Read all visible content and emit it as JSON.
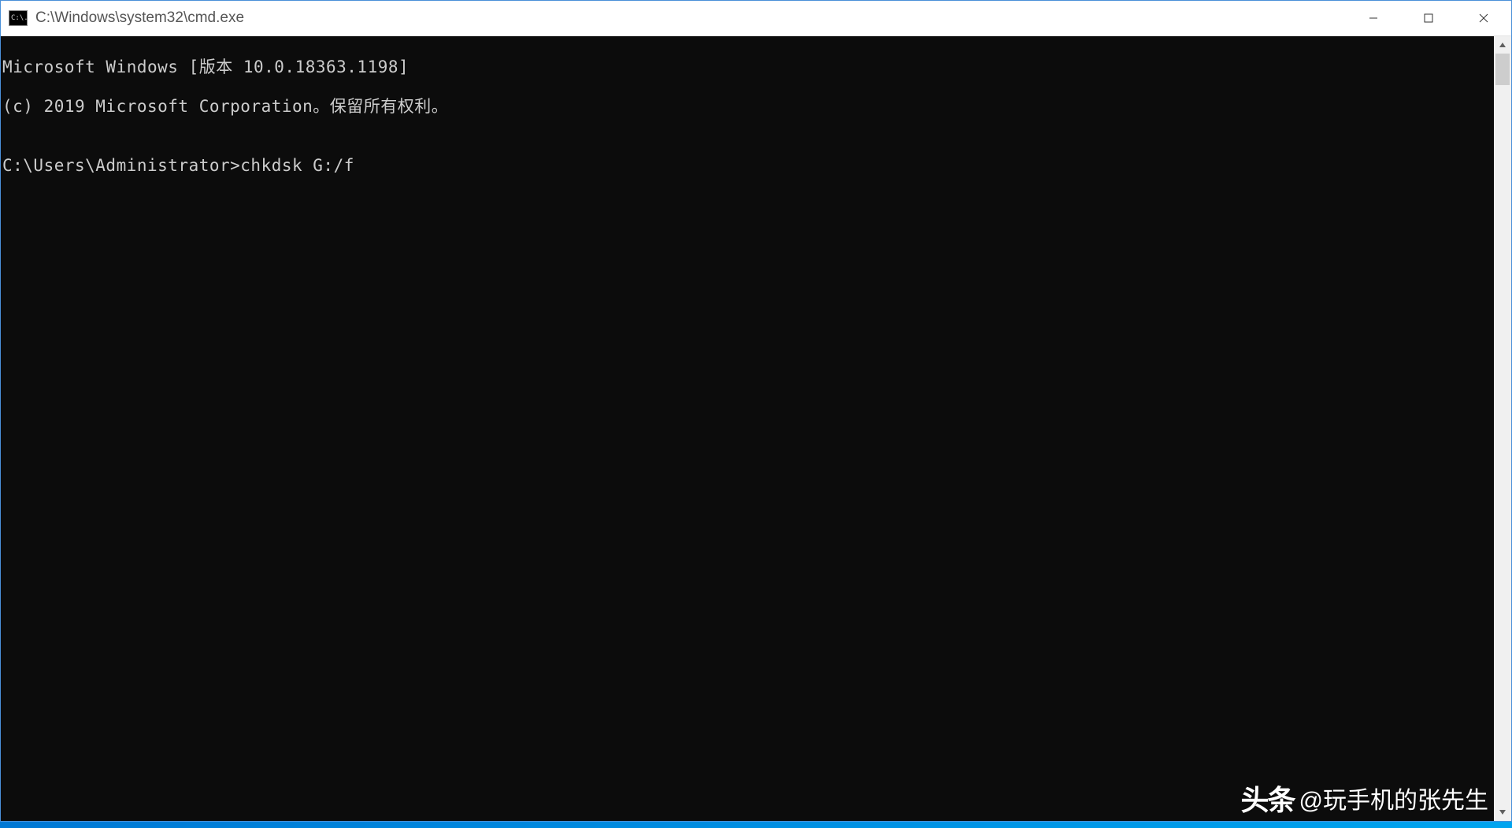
{
  "window": {
    "title": "C:\\Windows\\system32\\cmd.exe",
    "icon_label": "C:\\."
  },
  "console": {
    "lines": [
      "Microsoft Windows [版本 10.0.18363.1198]",
      "(c) 2019 Microsoft Corporation。保留所有权利。",
      "",
      "C:\\Users\\Administrator>chkdsk G:/f"
    ],
    "prompt": "C:\\Users\\Administrator>",
    "command": "chkdsk G:/f"
  },
  "watermark": {
    "logo": "头条",
    "handle": "@玩手机的张先生"
  }
}
